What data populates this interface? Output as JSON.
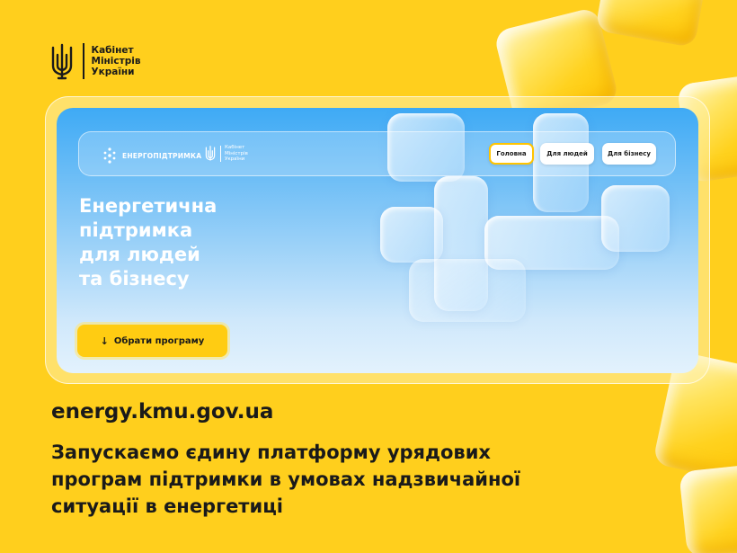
{
  "gov_logo": {
    "name_lines": [
      "Кабінет",
      "Міністрів",
      "України"
    ]
  },
  "site": {
    "brand": "ЕНЕРГОПІДТРИМКА",
    "kmu_lines": [
      "Кабінет",
      "Міністрів",
      "України"
    ],
    "nav": [
      {
        "label": "Головна",
        "active": true
      },
      {
        "label": "Для людей",
        "active": false
      },
      {
        "label": "Для бізнесу",
        "active": false
      }
    ],
    "hero_title_lines": [
      "Енергетична",
      "підтримка",
      "для людей",
      "та бізнесу"
    ],
    "cta_label": "Обрати програму",
    "cta_icon": "arrow-down-icon"
  },
  "url": "energy.kmu.gov.ua",
  "headline_lines": [
    "Запускаємо єдину платформу урядових",
    "програм підтримки в умовах надзвичайної",
    "ситуації в енергетиці"
  ],
  "colors": {
    "background": "#ffcf1d",
    "accent_yellow": "#ffcc12",
    "hero_blue": "#3eaaf5",
    "text_dark": "#1a1a1a"
  }
}
